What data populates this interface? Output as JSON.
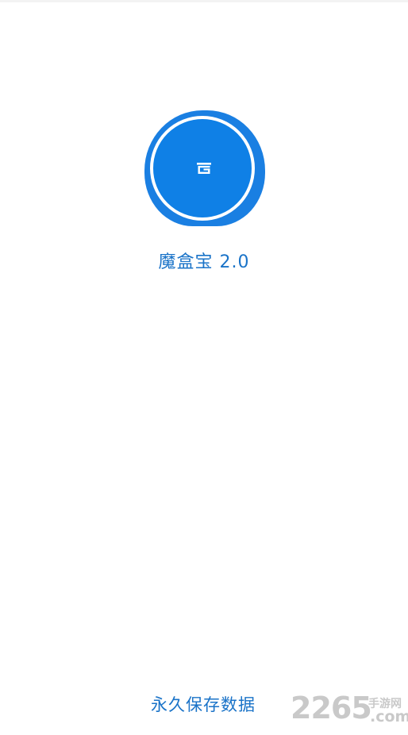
{
  "app": {
    "name": "魔盒宝 2.0",
    "icon": "magic-box-logo-icon",
    "accent_color": "#1a7fe2"
  },
  "footer": {
    "text": "永久保存数据"
  },
  "watermark": {
    "number": "2265",
    "site_cn": "手游网",
    "suffix": ".com",
    "color": "#c9c9c9"
  }
}
